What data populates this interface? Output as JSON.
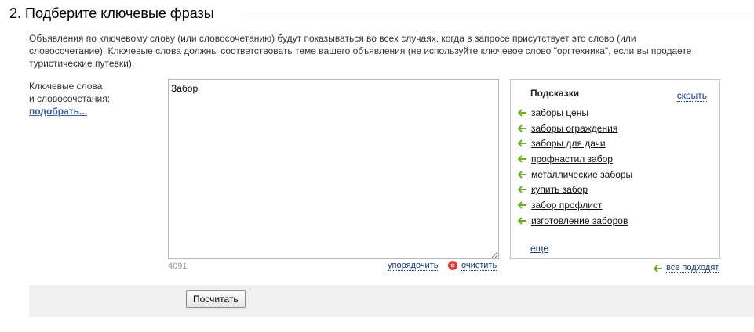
{
  "section": {
    "title": "2. Подберите ключевые фразы",
    "description": "Объявления по ключевому слову (или словосочетанию) будут показываться во всех случаях, когда в запросе присутствует это слово (или словосочетание). Ключевые слова должны соответствовать теме вашего объявления (не используйте ключевое слово \"оргтехника\", если вы продаете туристические путевки)."
  },
  "keywords": {
    "label_line1": "Ключевые слова",
    "label_line2": "и словосочетания:",
    "pick_link": "подобрать...",
    "value": "Забор",
    "char_count": "4091",
    "sort_link": "упорядочить",
    "clear_link": "очистить"
  },
  "hints": {
    "title": "Подсказки",
    "hide_link": "скрыть",
    "items": [
      "заборы цены",
      "заборы ограждения",
      "заборы для дачи",
      "профнастил забор",
      "металлические заборы",
      "купить забор",
      "забор профлист",
      "изготовление заборов"
    ],
    "more_link": "еще",
    "all_fit_link": "все подходят"
  },
  "footer": {
    "calc_button": "Посчитать"
  },
  "colors": {
    "link": "#1a3b7a",
    "arrow": "#6ab02a",
    "clear_icon": "#d84040",
    "footer_bg": "#f0f0f0"
  },
  "icons": {
    "hint_arrow": "arrow-left-icon",
    "clear": "clear-x-icon"
  }
}
